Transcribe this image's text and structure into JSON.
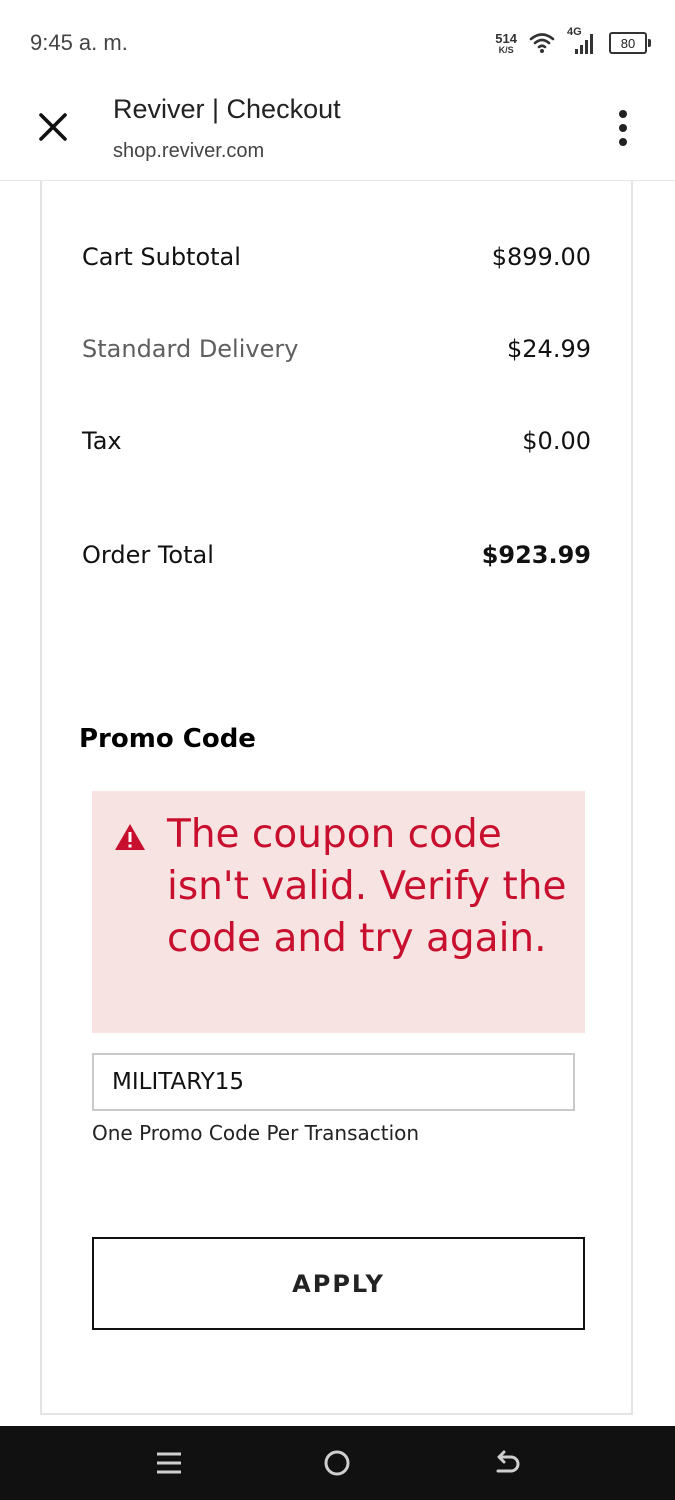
{
  "status_bar": {
    "time": "9:45 a. m.",
    "net_speed_value": "514",
    "net_speed_unit": "K/S",
    "network_type": "4G",
    "battery": "80"
  },
  "app_bar": {
    "title": "Reviver | Checkout",
    "url": "shop.reviver.com"
  },
  "summary": [
    {
      "label": "Cart Subtotal",
      "value": "$899.00"
    },
    {
      "label": "Standard Delivery",
      "value": "$24.99"
    },
    {
      "label": "Tax",
      "value": "$0.00"
    }
  ],
  "order_total": {
    "label": "Order Total",
    "value": "$923.99"
  },
  "promo": {
    "heading": "Promo Code",
    "error_message": "The coupon code isn't valid. Verify the code and try again.",
    "input_value": "MILITARY15",
    "note": "One Promo Code Per Transaction",
    "apply_label": "APPLY"
  },
  "colors": {
    "error_text": "#c8102e",
    "error_background": "#f8e3e3",
    "nav_bar": "#111111"
  },
  "icons": {
    "close": "close-icon",
    "menu": "more-vert-icon",
    "warning": "warning-icon",
    "nav_recents": "recents-icon",
    "nav_home": "home-icon",
    "nav_back": "back-icon"
  }
}
